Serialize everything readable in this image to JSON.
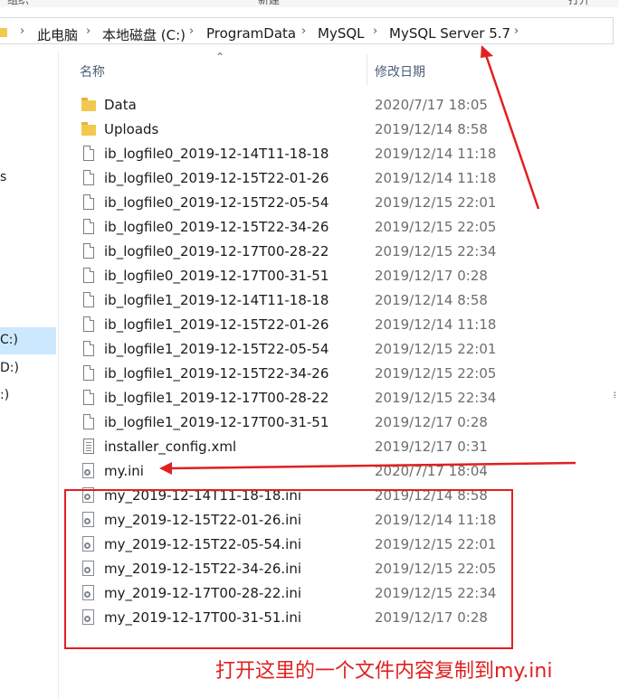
{
  "ribbon": {
    "items": [
      "组织",
      "新建",
      "打开"
    ]
  },
  "breadcrumb": [
    "此电脑",
    "本地磁盘 (C:)",
    "ProgramData",
    "MySQL",
    "MySQL Server 5.7"
  ],
  "nav": {
    "items": [
      "s",
      "C:)",
      "D:)",
      ":)"
    ]
  },
  "columns": {
    "name": "名称",
    "date": "修改日期"
  },
  "files": [
    {
      "name": "Data",
      "date": "2020/7/17 18:05",
      "icon": "folder-icon"
    },
    {
      "name": "Uploads",
      "date": "2019/12/14 8:58",
      "icon": "folder-icon"
    },
    {
      "name": "ib_logfile0_2019-12-14T11-18-18",
      "date": "2019/12/14 11:18",
      "icon": "file-icon"
    },
    {
      "name": "ib_logfile0_2019-12-15T22-01-26",
      "date": "2019/12/14 11:18",
      "icon": "file-icon"
    },
    {
      "name": "ib_logfile0_2019-12-15T22-05-54",
      "date": "2019/12/15 22:01",
      "icon": "file-icon"
    },
    {
      "name": "ib_logfile0_2019-12-15T22-34-26",
      "date": "2019/12/15 22:05",
      "icon": "file-icon"
    },
    {
      "name": "ib_logfile0_2019-12-17T00-28-22",
      "date": "2019/12/15 22:34",
      "icon": "file-icon"
    },
    {
      "name": "ib_logfile0_2019-12-17T00-31-51",
      "date": "2019/12/17 0:28",
      "icon": "file-icon"
    },
    {
      "name": "ib_logfile1_2019-12-14T11-18-18",
      "date": "2019/12/14 8:58",
      "icon": "file-icon"
    },
    {
      "name": "ib_logfile1_2019-12-15T22-01-26",
      "date": "2019/12/14 11:18",
      "icon": "file-icon"
    },
    {
      "name": "ib_logfile1_2019-12-15T22-05-54",
      "date": "2019/12/15 22:01",
      "icon": "file-icon"
    },
    {
      "name": "ib_logfile1_2019-12-15T22-34-26",
      "date": "2019/12/15 22:05",
      "icon": "file-icon"
    },
    {
      "name": "ib_logfile1_2019-12-17T00-28-22",
      "date": "2019/12/15 22:34",
      "icon": "file-icon"
    },
    {
      "name": "ib_logfile1_2019-12-17T00-31-51",
      "date": "2019/12/17 0:28",
      "icon": "file-icon"
    },
    {
      "name": "installer_config.xml",
      "date": "2019/12/17 0:31",
      "icon": "xml-file-icon"
    },
    {
      "name": "my.ini",
      "date": "2020/7/17 18:04",
      "icon": "ini-file-icon"
    },
    {
      "name": "my_2019-12-14T11-18-18.ini",
      "date": "2019/12/14 8:58",
      "icon": "ini-file-icon"
    },
    {
      "name": "my_2019-12-15T22-01-26.ini",
      "date": "2019/12/14 11:18",
      "icon": "ini-file-icon"
    },
    {
      "name": "my_2019-12-15T22-05-54.ini",
      "date": "2019/12/15 22:01",
      "icon": "ini-file-icon"
    },
    {
      "name": "my_2019-12-15T22-34-26.ini",
      "date": "2019/12/15 22:05",
      "icon": "ini-file-icon"
    },
    {
      "name": "my_2019-12-17T00-28-22.ini",
      "date": "2019/12/15 22:34",
      "icon": "ini-file-icon"
    },
    {
      "name": "my_2019-12-17T00-31-51.ini",
      "date": "2019/12/17 0:28",
      "icon": "ini-file-icon"
    }
  ],
  "annotation": {
    "note": "打开这里的一个文件内容复制到my.ini",
    "color": "#e02020"
  },
  "side_mark": "፧"
}
